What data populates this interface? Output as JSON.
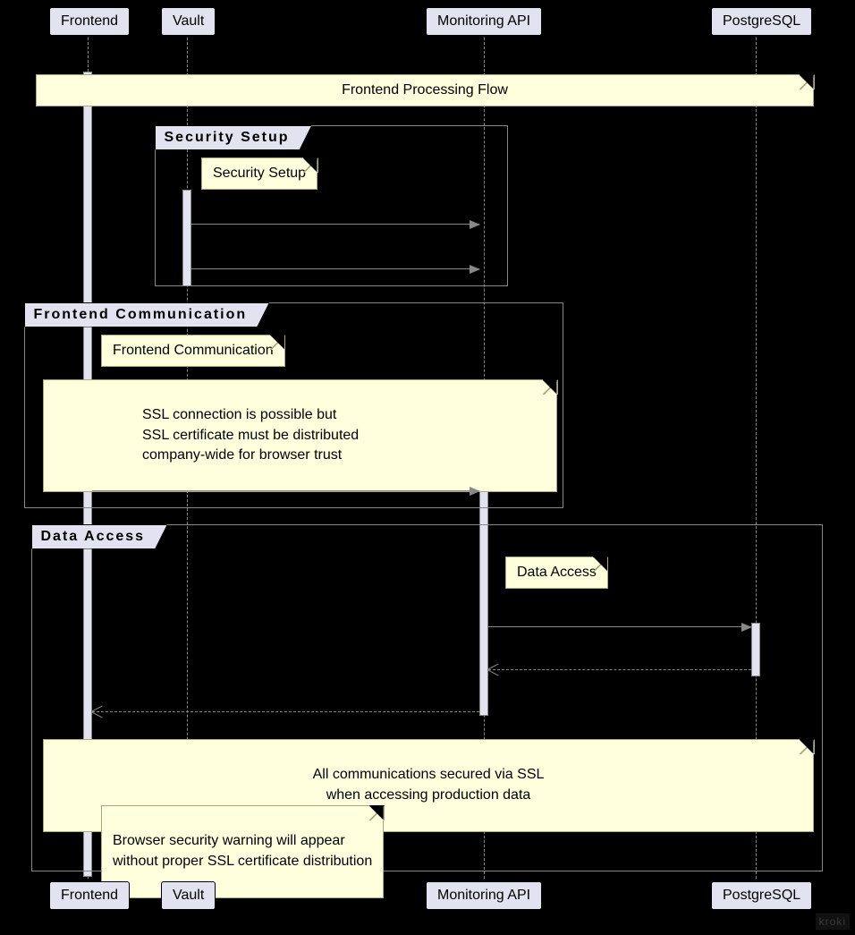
{
  "participants": {
    "frontend": {
      "label": "Frontend"
    },
    "vault": {
      "label": "Vault"
    },
    "monitoring": {
      "label": "Monitoring API"
    },
    "postgres": {
      "label": "PostgreSQL"
    }
  },
  "notes": {
    "main_title": "Frontend Processing Flow",
    "security_setup_note": "Security Setup",
    "frontend_comm_note": "Frontend Communication",
    "ssl_possible": "SSL connection is possible but\nSSL certificate must be distributed\ncompany-wide for browser trust",
    "data_access_note": "Data Access",
    "all_comm": "All communications secured via SSL\nwhen accessing production data",
    "browser_warn": "Browser security warning will appear\nwithout proper SSL certificate distribution"
  },
  "groups": {
    "security_setup": "Security Setup",
    "frontend_comm": "Frontend Communication",
    "data_access": "Data Access"
  },
  "watermark": "kroki"
}
